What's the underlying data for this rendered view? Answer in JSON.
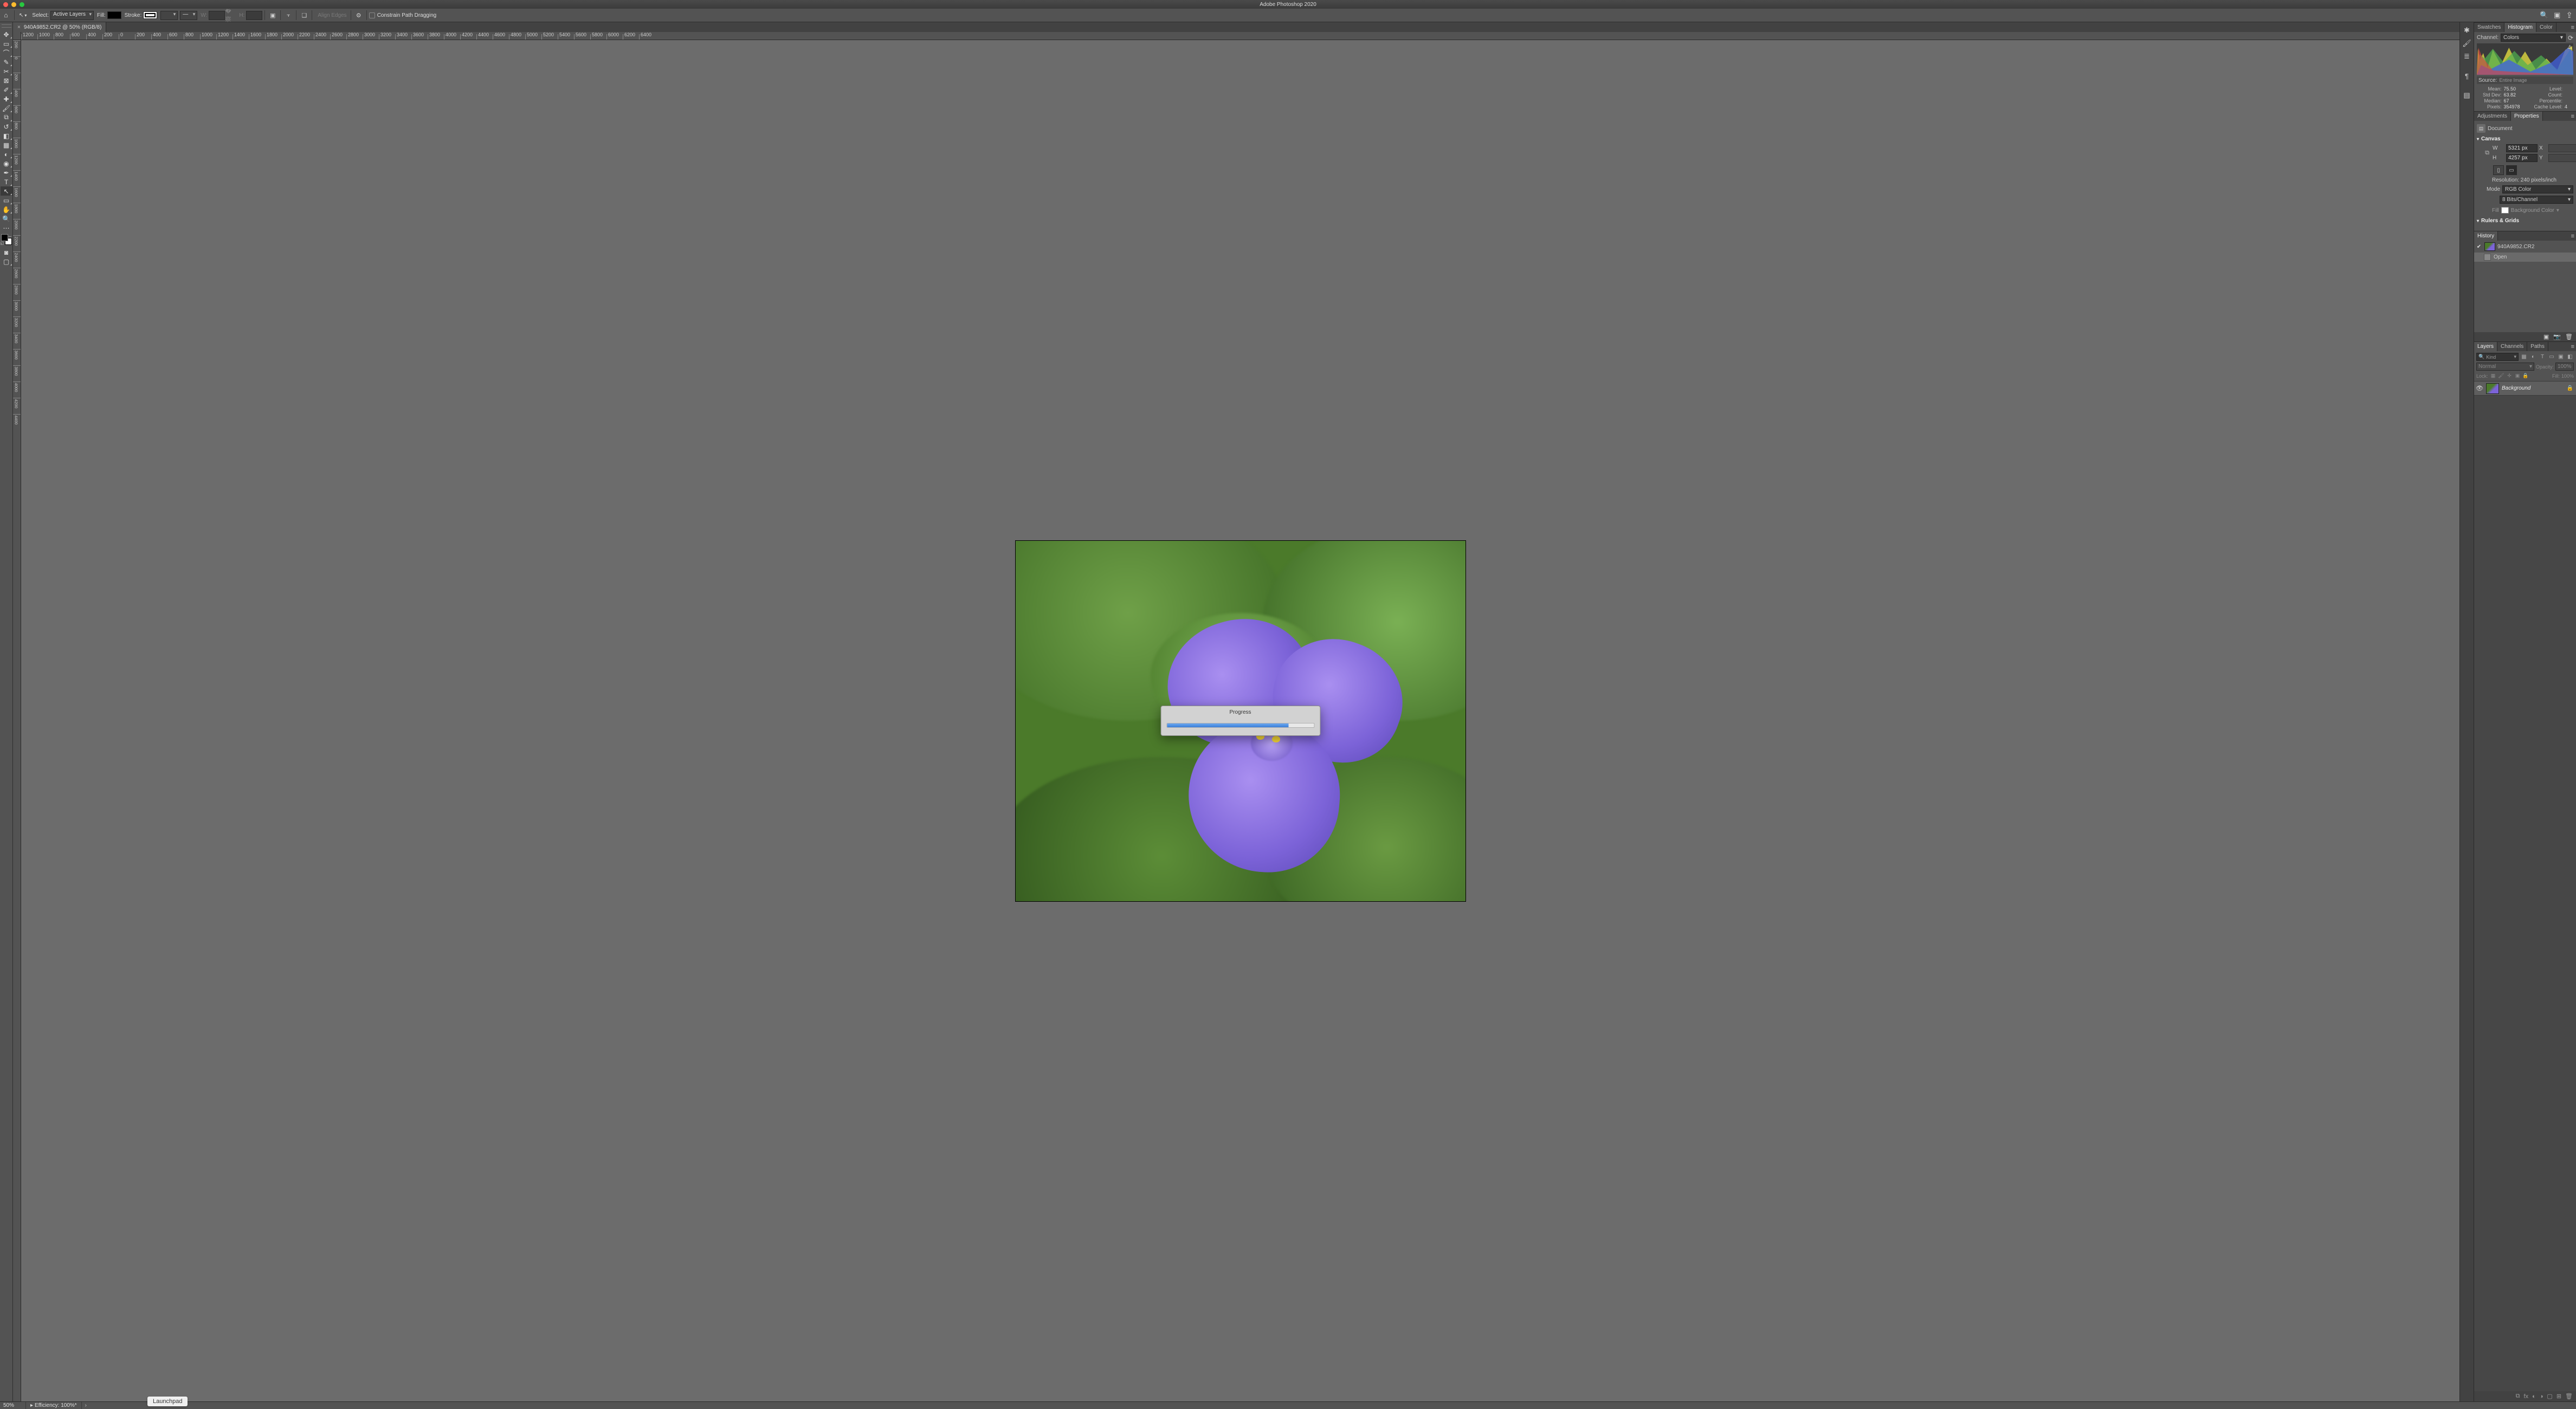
{
  "window": {
    "title": "Adobe Photoshop 2020"
  },
  "options_bar": {
    "select_label": "Select:",
    "select_value": "Active Layers",
    "fill_label": "Fill:",
    "stroke_label": "Stroke:",
    "stroke_width": "",
    "w_label": "W:",
    "h_label": "H:",
    "align_edges": "Align Edges",
    "constrain": "Constrain Path Dragging"
  },
  "document": {
    "tab_title": "940A9852.CR2 @ 50% (RGB/8)",
    "ruler_h": [
      "1200",
      "1000",
      "800",
      "600",
      "400",
      "200",
      "0",
      "200",
      "400",
      "600",
      "800",
      "1000",
      "1200",
      "1400",
      "1600",
      "1800",
      "2000",
      "2200",
      "2400",
      "2600",
      "2800",
      "3000",
      "3200",
      "3400",
      "3600",
      "3800",
      "4000",
      "4200",
      "4400",
      "4600",
      "4800",
      "5000",
      "5200",
      "5400",
      "5600",
      "5800",
      "6000",
      "6200",
      "6400"
    ],
    "ruler_v": [
      "200",
      "0",
      "200",
      "400",
      "600",
      "800",
      "1000",
      "1200",
      "1400",
      "1600",
      "1800",
      "2000",
      "2200",
      "2400",
      "2600",
      "2800",
      "3000",
      "3200",
      "3400",
      "3600",
      "3800",
      "4000",
      "4200",
      "4400"
    ]
  },
  "progress": {
    "title": "Progress",
    "percent": 83
  },
  "histogram": {
    "tabs": [
      "Swatches",
      "Histogram",
      "Color"
    ],
    "channel_label": "Channel:",
    "channel_value": "Colors",
    "source_label": "Source:",
    "source_value": "Entire Image",
    "stats": {
      "mean_label": "Mean:",
      "mean": "75.50",
      "stddev_label": "Std Dev:",
      "stddev": "63.82",
      "median_label": "Median:",
      "median": "67",
      "pixels_label": "Pixels:",
      "pixels": "354978",
      "level_label": "Level:",
      "count_label": "Count:",
      "percentile_label": "Percentile:",
      "cache_label": "Cache Level:",
      "cache": "4"
    }
  },
  "properties": {
    "tabs": [
      "Adjustments",
      "Properties"
    ],
    "doc_label": "Document",
    "canvas_hdr": "Canvas",
    "w_label": "W",
    "w_value": "5321 px",
    "h_label": "H",
    "h_value": "4257 px",
    "x_label": "X",
    "y_label": "Y",
    "resolution": "Resolution: 240 pixels/inch",
    "mode_label": "Mode",
    "mode_value": "RGB Color",
    "depth_value": "8 Bits/Channel",
    "fill_label": "Fill",
    "fill_value": "Background Color",
    "rulers_hdr": "Rulers & Grids"
  },
  "history": {
    "tab": "History",
    "snapshot": "940A9852.CR2",
    "step": "Open"
  },
  "layers": {
    "tabs": [
      "Layers",
      "Channels",
      "Paths"
    ],
    "kind_placeholder": "Kind",
    "blend_mode": "Normal",
    "opacity_label": "Opacity:",
    "opacity_value": "100%",
    "lock_label": "Lock:",
    "fill_label": "Fill:",
    "fill_value": "100%",
    "layer_name": "Background"
  },
  "status": {
    "zoom": "50%",
    "efficiency": "Efficiency: 100%*"
  },
  "dock_tooltip": "Launchpad"
}
